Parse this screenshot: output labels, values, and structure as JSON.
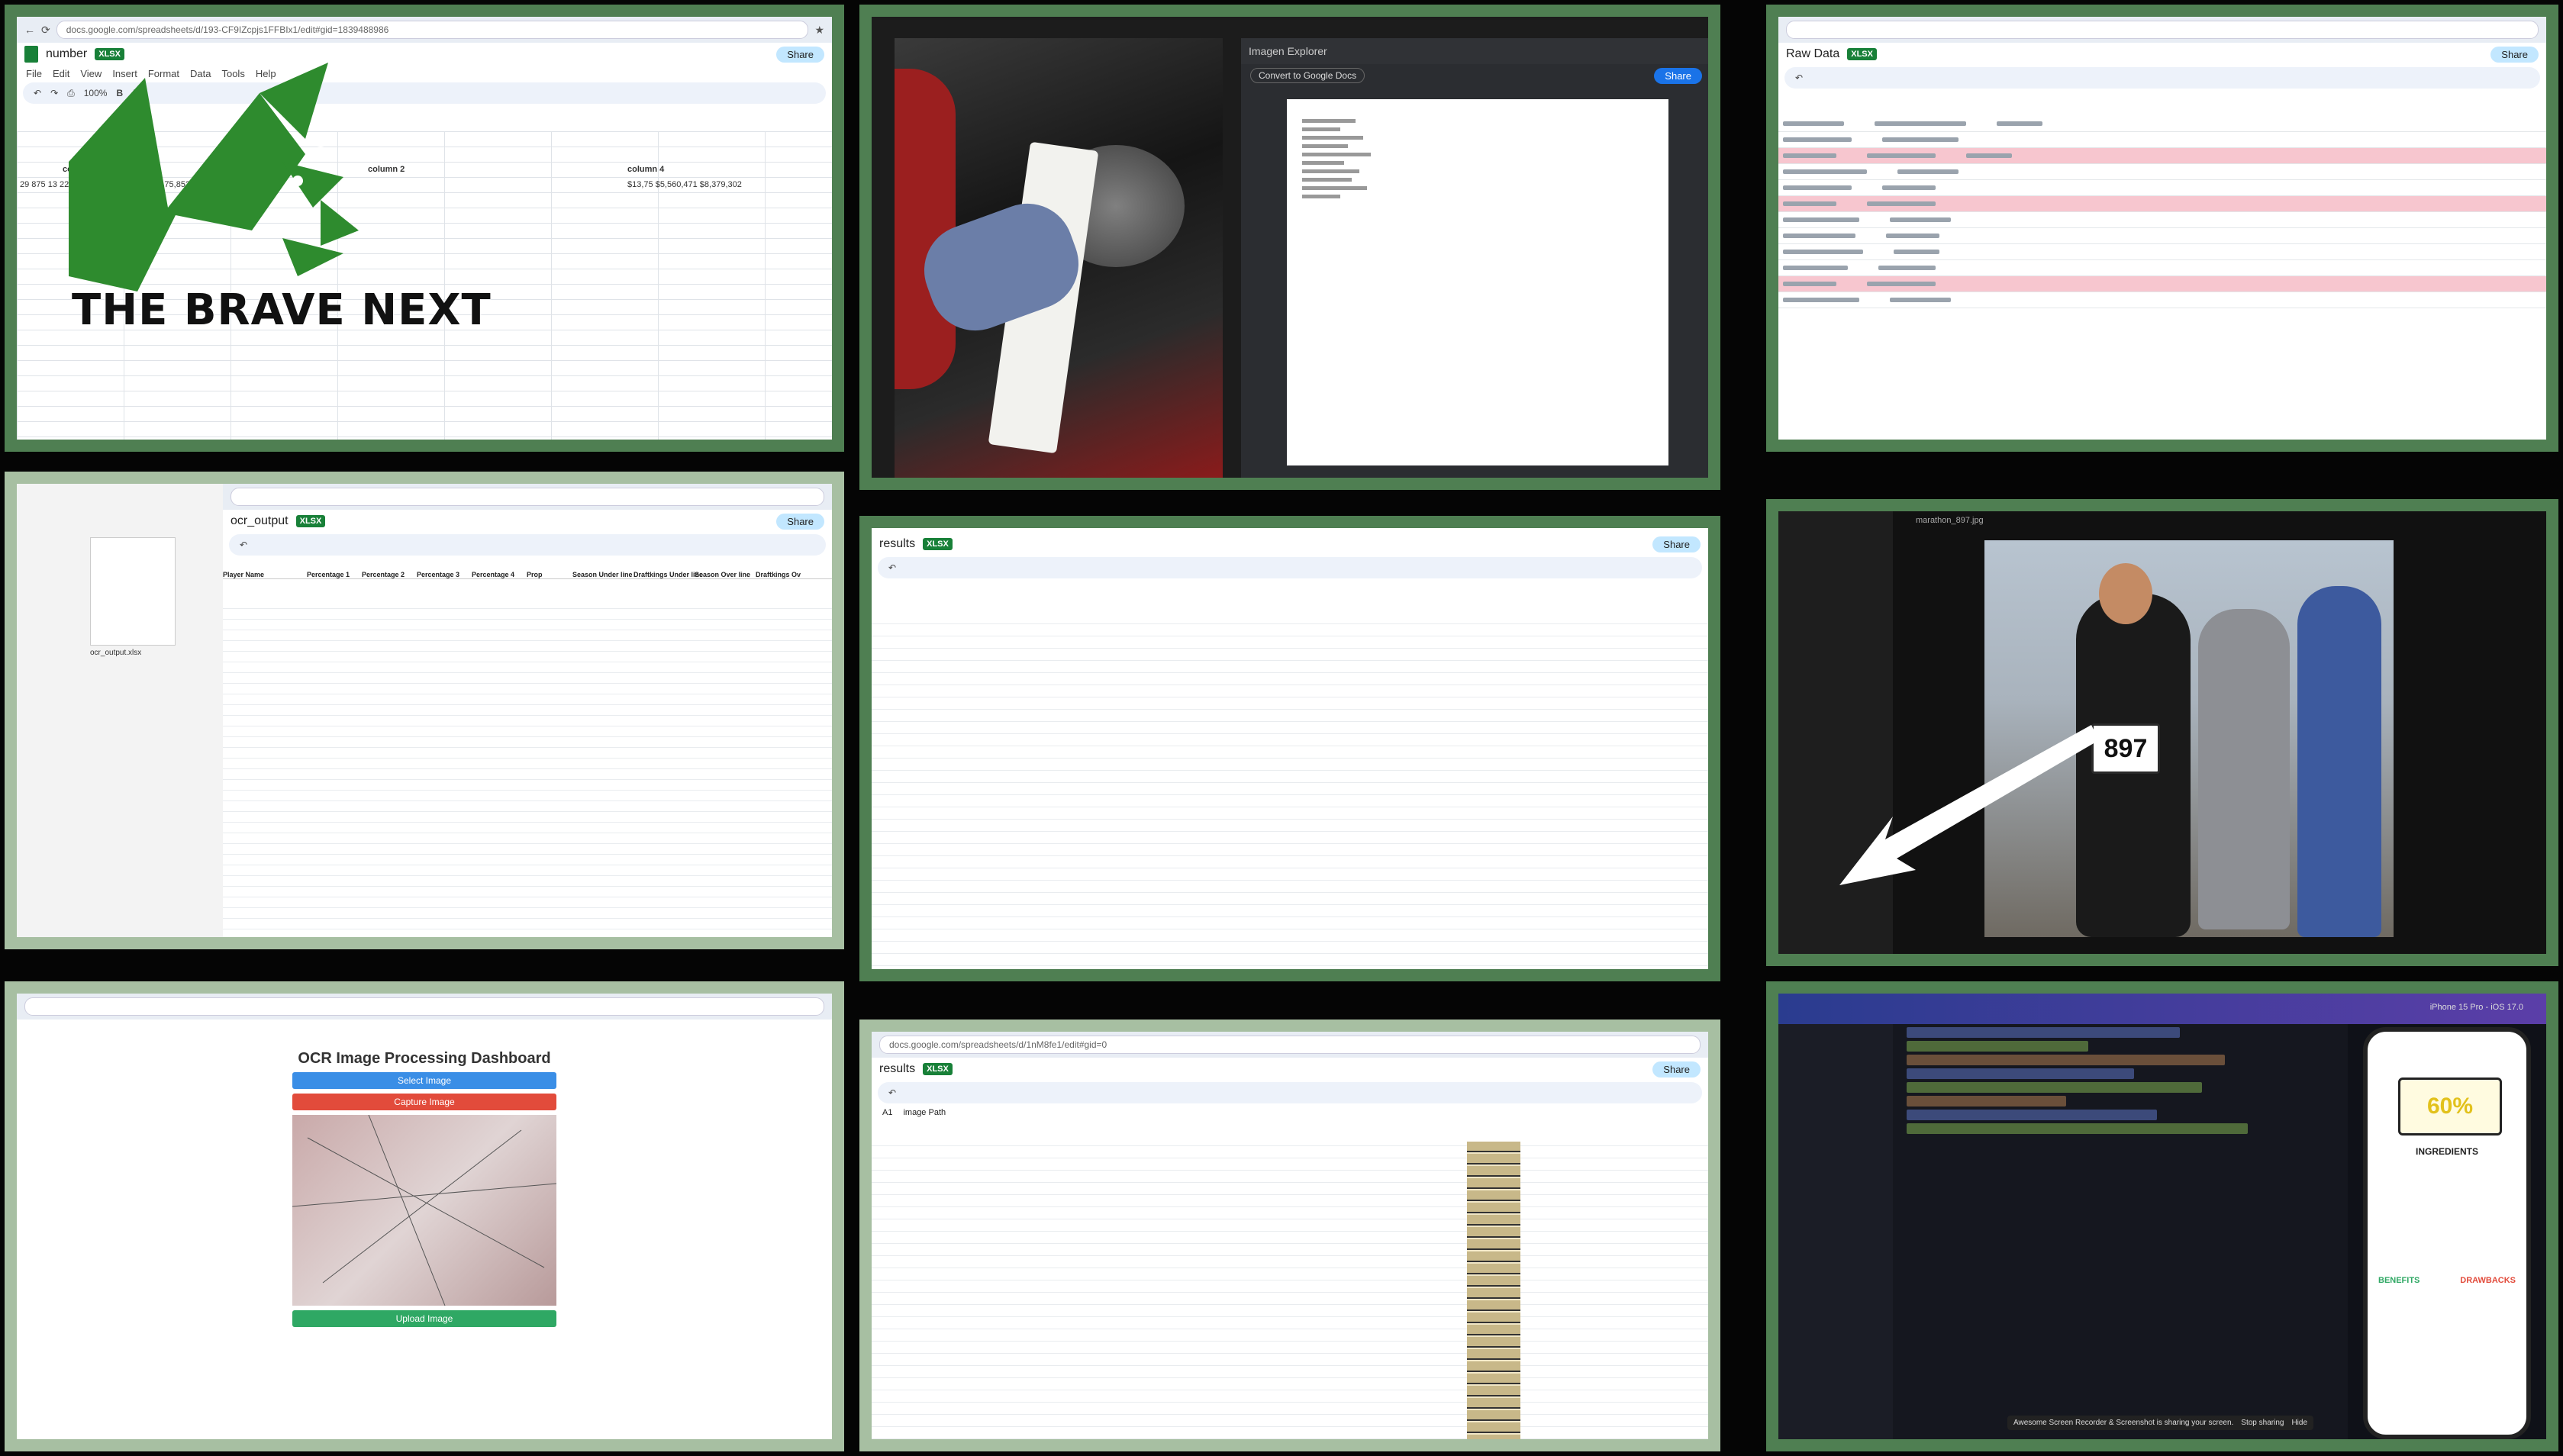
{
  "logo": {
    "brand_text": "THE BRAVE NEXT",
    "brand_color": "#2e8b2e"
  },
  "tile1": {
    "url": "docs.google.com/spreadsheets/d/193-CF9IZcpjs1FFBIx1/edit#gid=1839488986",
    "sheet_name": "number",
    "badge": "XLSX",
    "menu": [
      "File",
      "Edit",
      "View",
      "Insert",
      "Format",
      "Data",
      "Tools",
      "Help"
    ],
    "zoom": "100%",
    "share": "Share",
    "col_a_header": "column 1",
    "col_b_header": "column 2",
    "col_c_header": "column 4",
    "row_values": "29 875 13 225 15 271 | 1,475,550 $2,475,852 $4,451,113 $2,602,862",
    "row_values_right": "$13,75 $5,560,471 $8,379,302"
  },
  "tile2": {
    "tab_label": "Imagen Explorer",
    "app_label": "Convert to Google Docs",
    "share": "Share"
  },
  "tile3": {
    "sheet_name": "Raw Data",
    "badge": "XLSX",
    "share": "Share"
  },
  "tile4": {
    "file_name": "ocr_output.xlsx",
    "sheet_name": "ocr_output",
    "badge": "XLSX",
    "share": "Share",
    "headers": [
      "Player Name",
      "Percentage 1",
      "Percentage 2",
      "Percentage 3",
      "Percentage 4",
      "Prop",
      "Season Under line",
      "Draftkings Under line",
      "Season Over line",
      "Draftkings Ov"
    ]
  },
  "tile5": {
    "sheet_name": "results",
    "badge": "XLSX",
    "share": "Share"
  },
  "tile6": {
    "bib_number": "897",
    "file_name": "marathon_897.jpg"
  },
  "tile7": {
    "title": "OCR Image Processing Dashboard",
    "select_label": "Select Image",
    "capture_label": "Capture Image",
    "upload_label": "Upload Image"
  },
  "tile8": {
    "url": "docs.google.com/spreadsheets/d/1nM8fe1/edit#gid=0",
    "sheet_name": "results",
    "badge": "XLSX",
    "share": "Share",
    "formula_ref": "A1",
    "formula": "image Path"
  },
  "tile9": {
    "phone_model": "iPhone 15 Pro - iOS 17.0",
    "percentage": "60%",
    "ingredients_label": "INGREDIENTS",
    "benefits_label": "BENEFITS",
    "drawbacks_label": "DRAWBACKS",
    "status_bar": "Awesome Screen Recorder & Screenshot is sharing your screen.",
    "stop_sharing": "Stop sharing",
    "hide": "Hide"
  }
}
